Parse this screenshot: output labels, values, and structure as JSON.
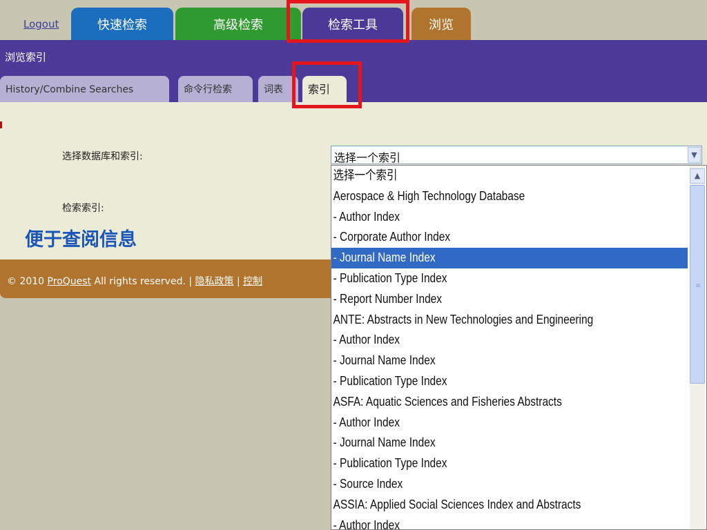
{
  "top_nav": {
    "logout": "Logout",
    "tabs": [
      {
        "label": "快速检索",
        "color": "#1b6ebd"
      },
      {
        "label": "高级检索",
        "color": "#2f9a2f"
      },
      {
        "label": "检索工具",
        "color": "#4b3998"
      },
      {
        "label": "浏览",
        "color": "#b0742e"
      }
    ]
  },
  "breadcrumb": "浏览索引",
  "sub_tabs": [
    {
      "label": "History/Combine Searches"
    },
    {
      "label": "命令行检索"
    },
    {
      "label": "词表"
    },
    {
      "label": "索引"
    }
  ],
  "form": {
    "select_db_label": "选择数据库和索引:",
    "search_index_label": "检索索引:",
    "select_value": "选择一个索引"
  },
  "annotation": "便于查阅信息",
  "footer": {
    "copyright": "© 2010",
    "proquest": "ProQuest",
    "rights": "All rights reserved. |",
    "privacy": "隐私政策",
    "sep": "|",
    "control": "控制"
  },
  "dropdown": {
    "selected_index": 4,
    "options": [
      "选择一个索引",
      "Aerospace & High Technology Database",
      "- Author Index",
      "- Corporate Author Index",
      "- Journal Name Index",
      "- Publication Type Index",
      "- Report Number Index",
      "ANTE: Abstracts in New Technologies and Engineering",
      "- Author Index",
      "- Journal Name Index",
      "- Publication Type Index",
      "ASFA: Aquatic Sciences and Fisheries Abstracts",
      "- Author Index",
      "- Journal Name Index",
      "- Publication Type Index",
      "- Source Index",
      "ASSIA: Applied Social Sciences Index and Abstracts",
      "- Author Index"
    ]
  },
  "colors": {
    "highlight_box": "#e4161c",
    "selected_option": "#316ac5",
    "annotation_text": "#1a56b8"
  }
}
